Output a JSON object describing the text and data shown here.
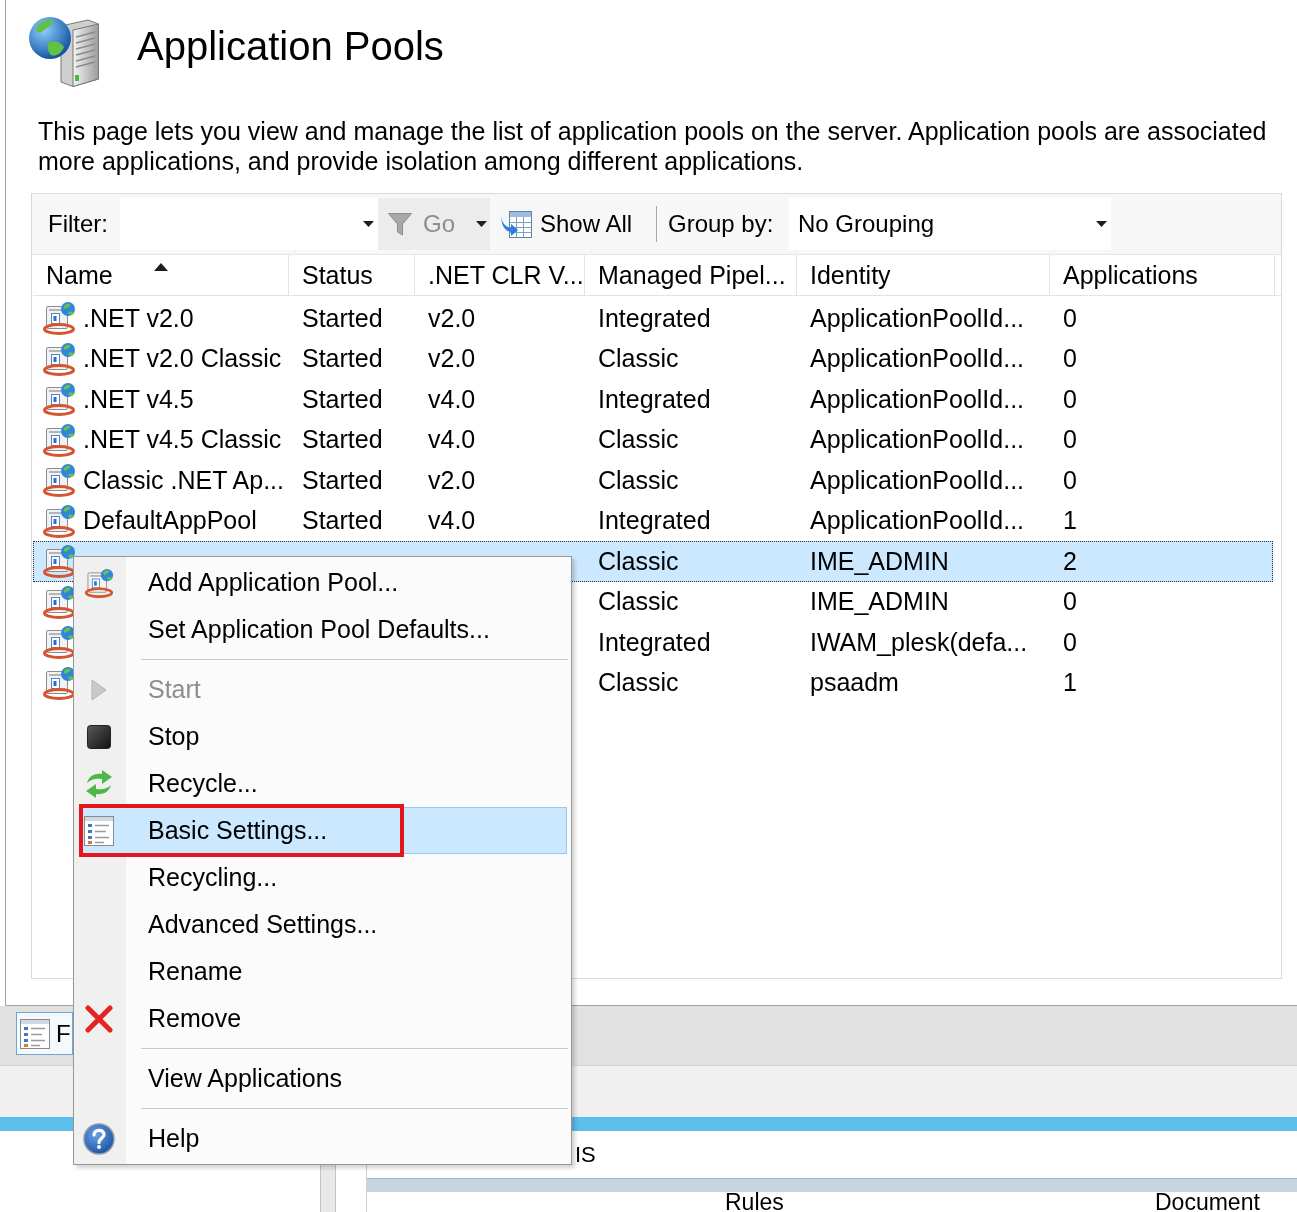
{
  "header": {
    "title": "Application Pools",
    "description_lines": [
      "This page lets you view and manage the list of application pools on the server. Application pools are associated",
      "more applications, and provide isolation among different applications."
    ]
  },
  "toolbar": {
    "filter_label": "Filter:",
    "go_button": {
      "label": "Go",
      "disabled": true
    },
    "show_all_button": {
      "label": "Show All"
    },
    "group_by_label": "Group by:",
    "group_by_value": "No Grouping"
  },
  "table": {
    "columns": [
      {
        "label": "Name",
        "sorted": true
      },
      {
        "label": "Status",
        "sorted": false
      },
      {
        "label": ".NET CLR V...",
        "sorted": false
      },
      {
        "label": "Managed Pipel...",
        "sorted": false
      },
      {
        "label": "Identity",
        "sorted": false
      },
      {
        "label": "Applications",
        "sorted": false
      }
    ],
    "rows": [
      {
        "name": ".NET v2.0",
        "status": "Started",
        "net_clr": "v2.0",
        "managed_pipeline": "Integrated",
        "identity": "ApplicationPoolId...",
        "applications": "0",
        "selected": false
      },
      {
        "name": ".NET v2.0 Classic",
        "status": "Started",
        "net_clr": "v2.0",
        "managed_pipeline": "Classic",
        "identity": "ApplicationPoolId...",
        "applications": "0",
        "selected": false
      },
      {
        "name": ".NET v4.5",
        "status": "Started",
        "net_clr": "v4.0",
        "managed_pipeline": "Integrated",
        "identity": "ApplicationPoolId...",
        "applications": "0",
        "selected": false
      },
      {
        "name": ".NET v4.5 Classic",
        "status": "Started",
        "net_clr": "v4.0",
        "managed_pipeline": "Classic",
        "identity": "ApplicationPoolId...",
        "applications": "0",
        "selected": false
      },
      {
        "name": "Classic .NET Ap...",
        "status": "Started",
        "net_clr": "v2.0",
        "managed_pipeline": "Classic",
        "identity": "ApplicationPoolId...",
        "applications": "0",
        "selected": false
      },
      {
        "name": "DefaultAppPool",
        "status": "Started",
        "net_clr": "v4.0",
        "managed_pipeline": "Integrated",
        "identity": "ApplicationPoolId...",
        "applications": "1",
        "selected": false
      },
      {
        "managed_pipeline": "Classic",
        "identity": "IME_ADMIN",
        "applications": "2",
        "selected": true
      },
      {
        "managed_pipeline": "Classic",
        "identity": "IME_ADMIN",
        "applications": "0",
        "selected": false
      },
      {
        "managed_pipeline": "Integrated",
        "identity": "IWAM_plesk(defa...",
        "applications": "0",
        "selected": false
      },
      {
        "managed_pipeline": "Classic",
        "identity": "psaadm",
        "applications": "1",
        "selected": false
      }
    ]
  },
  "context_menu": {
    "items": [
      {
        "kind": "pool",
        "label": "Add Application Pool...",
        "disabled": false,
        "selected": false,
        "annotated": false
      },
      {
        "kind": "plain",
        "label": "Set Application Pool Defaults...",
        "disabled": false,
        "selected": false,
        "annotated": false
      },
      {
        "kind": "separator"
      },
      {
        "kind": "play",
        "label": "Start",
        "disabled": true,
        "selected": false,
        "annotated": false
      },
      {
        "kind": "stop",
        "label": "Stop",
        "disabled": false,
        "selected": false,
        "annotated": false
      },
      {
        "kind": "recycle",
        "label": "Recycle...",
        "disabled": false,
        "selected": false,
        "annotated": false
      },
      {
        "kind": "form",
        "label": "Basic Settings...",
        "disabled": false,
        "selected": true,
        "annotated": true
      },
      {
        "kind": "plain",
        "label": "Recycling...",
        "disabled": false,
        "selected": false,
        "annotated": false
      },
      {
        "kind": "plain",
        "label": "Advanced Settings...",
        "disabled": false,
        "selected": false,
        "annotated": false
      },
      {
        "kind": "plain",
        "label": "Rename",
        "disabled": false,
        "selected": false,
        "annotated": false
      },
      {
        "kind": "delete",
        "label": "Remove",
        "disabled": false,
        "selected": false,
        "annotated": false
      },
      {
        "kind": "separator"
      },
      {
        "kind": "plain",
        "label": "View Applications",
        "disabled": false,
        "selected": false,
        "annotated": false
      },
      {
        "kind": "separator"
      },
      {
        "kind": "help",
        "label": "Help",
        "disabled": false,
        "selected": false,
        "annotated": false
      }
    ]
  },
  "view_tabs": [
    {
      "label": "F",
      "selected": true
    }
  ],
  "lower_pane": {
    "label": "IS",
    "columns": [
      "Rules",
      "Document"
    ]
  }
}
